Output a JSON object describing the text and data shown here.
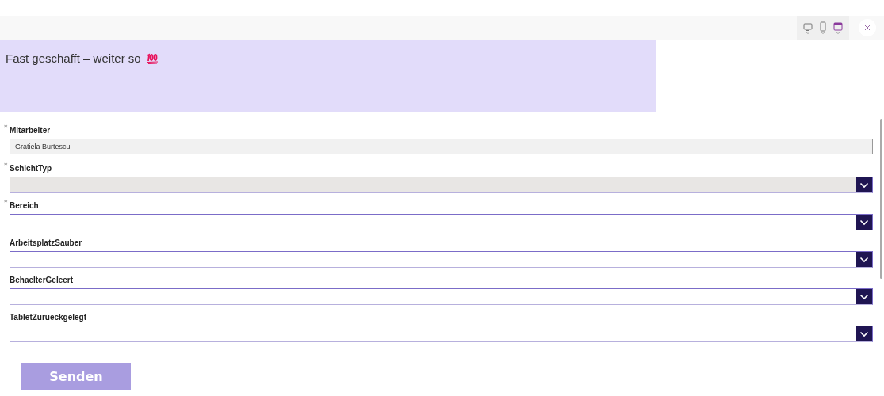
{
  "toolbar": {
    "devices": [
      {
        "kind": "monitor",
        "selected": false
      },
      {
        "kind": "phone",
        "selected": false
      },
      {
        "kind": "tablet",
        "selected": true
      }
    ]
  },
  "banner": {
    "title": "Fast geschafft – weiter so"
  },
  "fields": [
    {
      "kind": "text",
      "label": "Mitarbeiter",
      "required_mark": "*",
      "value": "Gratiela Burtescu",
      "disabled": true
    },
    {
      "kind": "dropdown",
      "label": "SchichtTyp",
      "required_mark": "*",
      "disabled": true
    },
    {
      "kind": "dropdown",
      "label": "Bereich",
      "required_mark": "*",
      "disabled": false
    },
    {
      "kind": "dropdown",
      "label": "ArbeitsplatzSauber",
      "disabled": false
    },
    {
      "kind": "dropdown",
      "label": "BehaelterGeleert",
      "disabled": false
    },
    {
      "kind": "dropdown",
      "label": "TabletZurueckgelegt",
      "disabled": false
    }
  ],
  "submit": {
    "label": "Senden"
  }
}
